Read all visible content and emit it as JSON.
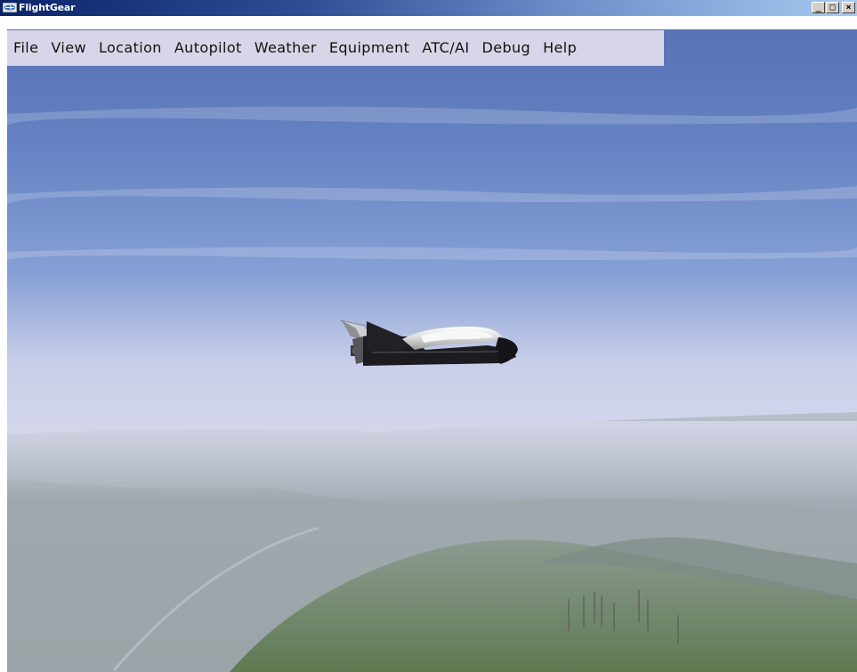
{
  "window": {
    "title": "FlightGear",
    "icon": "flightgear-app-icon",
    "controls": {
      "minimize_label": "_",
      "maximize_label": "□",
      "close_label": "×"
    }
  },
  "menubar": {
    "items": [
      {
        "id": "file",
        "label": "File"
      },
      {
        "id": "view",
        "label": "View"
      },
      {
        "id": "location",
        "label": "Location"
      },
      {
        "id": "autopilot",
        "label": "Autopilot"
      },
      {
        "id": "weather",
        "label": "Weather"
      },
      {
        "id": "equipment",
        "label": "Equipment"
      },
      {
        "id": "atc-ai",
        "label": "ATC/AI"
      },
      {
        "id": "debug",
        "label": "Debug"
      },
      {
        "id": "help",
        "label": "Help"
      }
    ]
  },
  "scene": {
    "colors": {
      "sky_top": "#5c78b8",
      "sky_mid": "#8fa5d6",
      "horizon_haze": "#cfd3ea",
      "terrain_far": "#9aa3ad",
      "terrain_near": "#6f7f66",
      "spacecraft_body": "#1e1e22",
      "spacecraft_top": "#f2f2f2"
    },
    "objects": [
      "spacecraft",
      "hazy-terrain",
      "radio-masts"
    ]
  }
}
